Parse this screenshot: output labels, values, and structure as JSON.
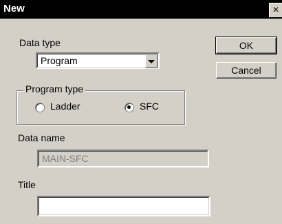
{
  "window": {
    "title": "New",
    "close_symbol": "×"
  },
  "data_type": {
    "label": "Data type",
    "selected": "Program"
  },
  "buttons": {
    "ok": "OK",
    "cancel": "Cancel"
  },
  "program_type": {
    "legend": "Program type",
    "options": [
      {
        "label": "Ladder",
        "checked": false
      },
      {
        "label": "SFC",
        "checked": true
      }
    ]
  },
  "data_name": {
    "label": "Data name",
    "value": "MAIN-SFC"
  },
  "title_field": {
    "label": "Title",
    "value": ""
  }
}
